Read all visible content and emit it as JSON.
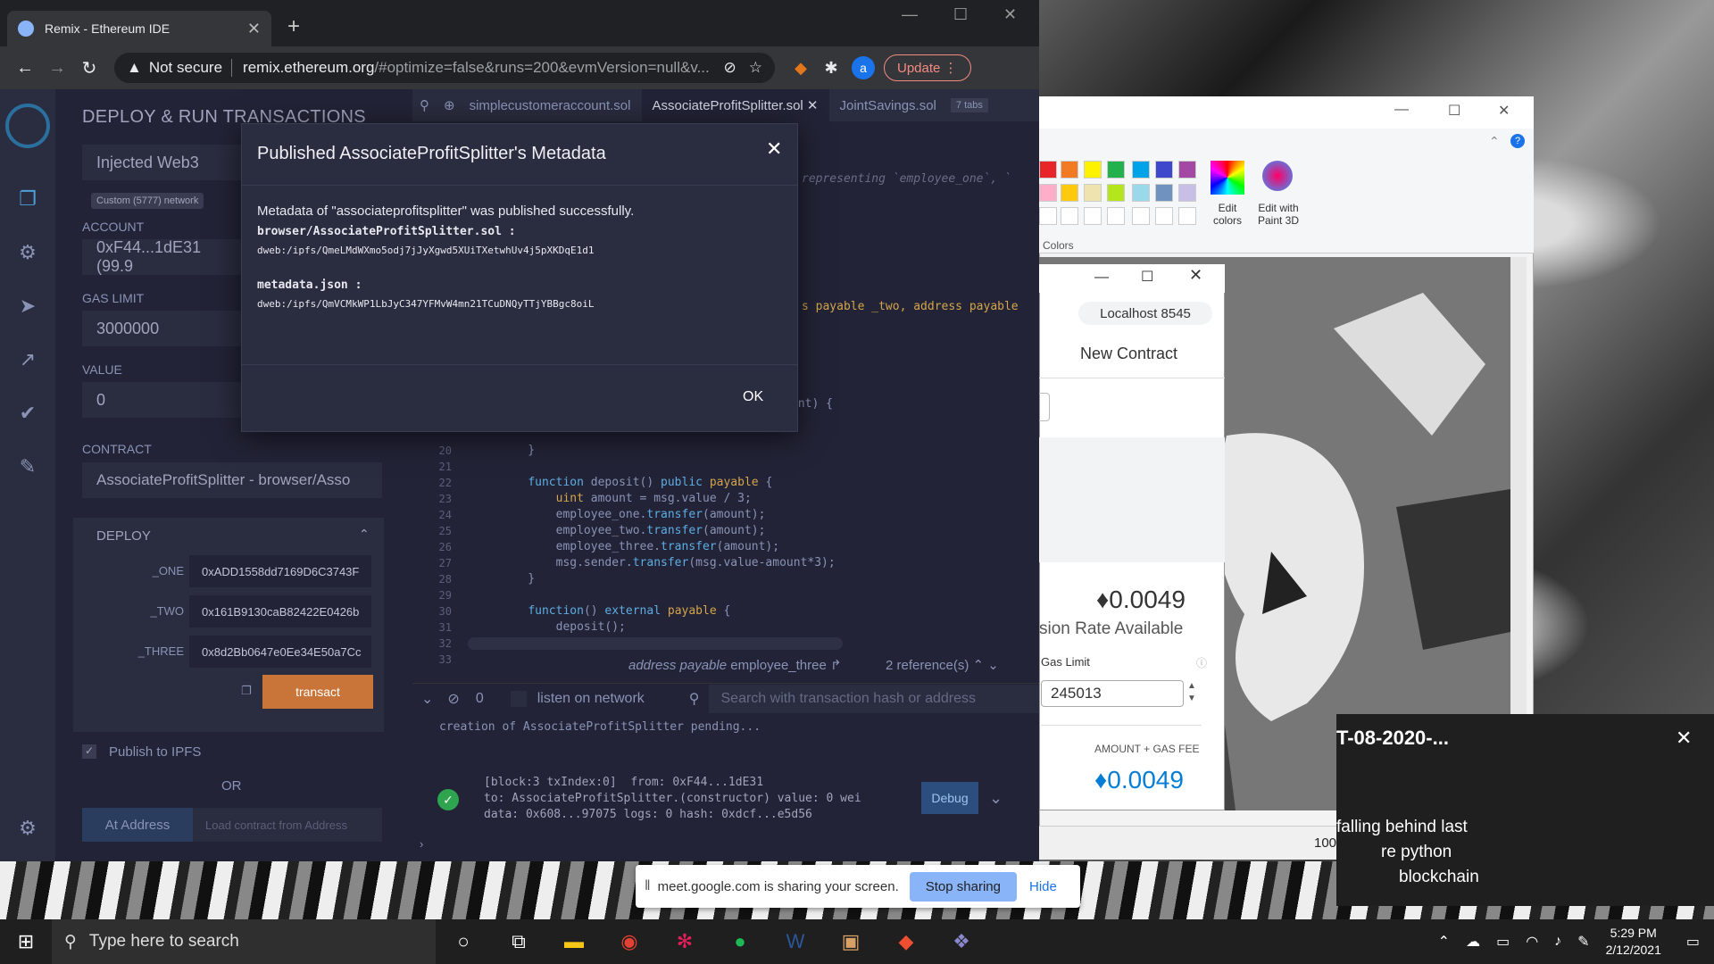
{
  "chrome": {
    "tab_title": "Remix - Ethereum IDE",
    "security": "Not secure",
    "url_host": "remix.ethereum.org",
    "url_rest": "/#optimize=false&runs=200&evmVersion=null&v...",
    "profile_initial": "a",
    "update_label": "Update"
  },
  "remix": {
    "panel_title": "DEPLOY & RUN TRANSACTIONS",
    "environment": "Injected Web3",
    "network_badge": "Custom (5777) network",
    "account_label": "ACCOUNT",
    "account_value": "0xF44...1dE31 (99.9",
    "gas_limit_label": "GAS LIMIT",
    "gas_limit_value": "3000000",
    "value_label": "VALUE",
    "value_value": "0",
    "contract_label": "CONTRACT",
    "contract_value": "AssociateProfitSplitter - browser/Asso",
    "deploy_label": "DEPLOY",
    "params": [
      {
        "label": "_ONE",
        "value": "0xADD1558dd7169D6C3743F"
      },
      {
        "label": "_TWO",
        "value": "0x161B9130caB82422E0426b"
      },
      {
        "label": "_THREE",
        "value": "0x8d2Bb0647e0Ee34E50a7Cc"
      }
    ],
    "transact_label": "transact",
    "publish_ipfs_label": "Publish to IPFS",
    "or_label": "OR",
    "at_address_label": "At Address",
    "load_contract_placeholder": "Load contract from Address",
    "editor_tabs": [
      "simplecustomeraccount.sol",
      "AssociateProfitSplitter.sol",
      "JointSavings.sol"
    ],
    "tabs_count": "7 tabs",
    "ref_hint_italic": "address payable",
    "ref_hint_name": "employee_three",
    "ref_count": "2 reference(s)",
    "term_count": "0",
    "listen_label": "listen on network",
    "search_tx_placeholder": "Search with transaction hash or address",
    "pending_line": "creation of AssociateProfitSplitter pending...",
    "tx_line1": "[block:3 txIndex:0]  from: 0xF44...1dE31",
    "tx_line2": "to: AssociateProfitSplitter.(constructor) value: 0 wei",
    "tx_line3": "data: 0x608...97075 logs: 0 hash: 0xdcf...e5d56",
    "debug_label": "Debug",
    "code_fragment_top": "representing `employee_one`, `",
    "code_fragment_mid": "s payable _two, address payable",
    "code_fragment_int": "int) {"
  },
  "modal": {
    "title": "Published AssociateProfitSplitter's Metadata",
    "message": "Metadata of \"associateprofitsplitter\" was published successfully.",
    "file1": "browser/AssociateProfitSplitter.sol :",
    "hash1": "dweb:/ipfs/QmeLMdWXmo5odj7jJyXgwd5XUiTXetwhUv4j5pXKDqE1d1",
    "file2": "metadata.json :",
    "hash2": "dweb:/ipfs/QmVCMkWP1LbJyC347YFMvW4mn21TCuDNQyTTjYBBgc8oiL",
    "ok_label": "OK"
  },
  "paint": {
    "edit_colors": "Edit colors",
    "edit_paint3d": "Edit with Paint 3D",
    "colors_group": "Colors",
    "zoom": "100%"
  },
  "metamask": {
    "network": "Localhost 8545",
    "new_contract": "New Contract",
    "amount1": "0.0049",
    "rate_available": "sion Rate Available",
    "gas_limit_label": "Gas Limit",
    "gas_limit_value": "245013",
    "amount_gas_fee_label": "AMOUNT + GAS FEE",
    "amount2": "0.0049"
  },
  "notification": {
    "title": "T-08-2020-...",
    "line1": "falling behind last",
    "line2": "re python",
    "line3": "blockchain"
  },
  "sharebar": {
    "message": "meet.google.com is sharing your screen.",
    "stop_label": "Stop sharing",
    "hide_label": "Hide"
  },
  "taskbar": {
    "search_placeholder": "Type here to search",
    "time": "5:29 PM",
    "date": "2/12/2021"
  }
}
